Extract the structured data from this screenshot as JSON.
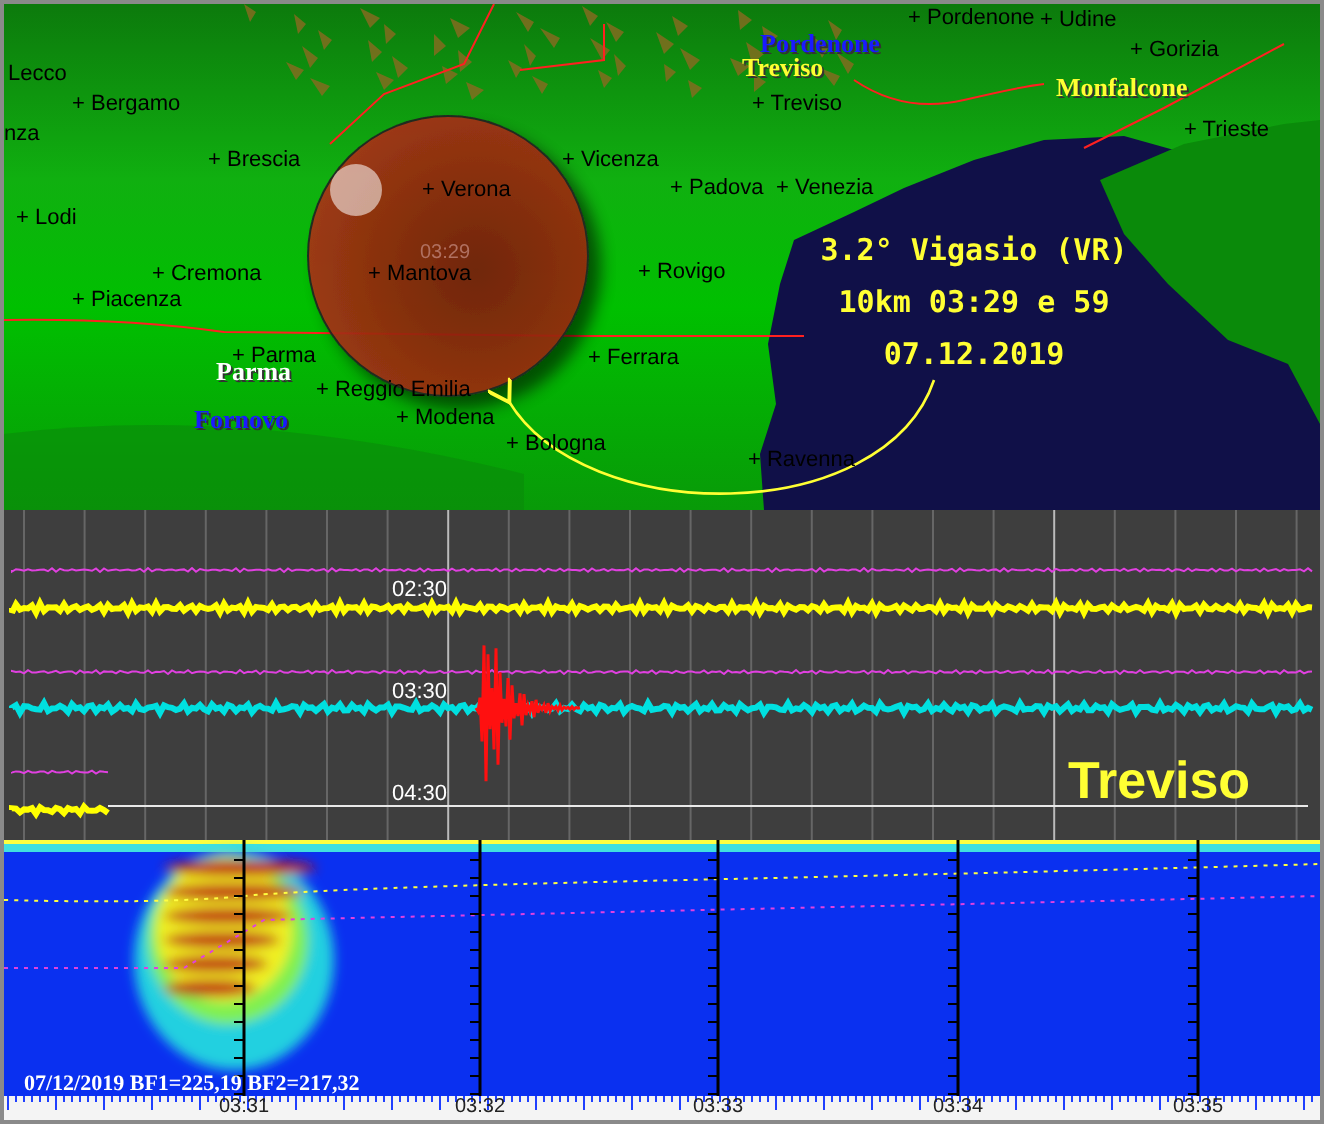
{
  "map": {
    "cities": [
      "Lecco",
      "+ Bergamo",
      "nza",
      "+ Brescia",
      "+ Lodi",
      "+ Cremona",
      "+ Piacenza",
      "+ Parma",
      "+ Reggio Emilia",
      "+ Modena",
      "+ Bologna",
      "+ Verona",
      "+ Mantova",
      "+ Vicenza",
      "+ Ferrara",
      "+ Padova",
      "+ Venezia",
      "+ Rovigo",
      "+ Treviso",
      "+ Pordenone",
      "+ Udine",
      "+ Gorizia",
      "+ Trieste",
      "+ Ravenna"
    ],
    "region_labels": [
      {
        "name": "Treviso",
        "color": "#ffff33"
      },
      {
        "name": "Monfalcone",
        "color": "#ffff33"
      },
      {
        "name": "Parma",
        "color": "#ffffff"
      },
      {
        "name": "Fornovo",
        "color": "#1a1aff"
      },
      {
        "name": "Pordenone",
        "color": "#1a1aff"
      }
    ],
    "epicenter": {
      "time": "03:29"
    },
    "event": {
      "lines": [
        "3.2° Vigasio (VR)",
        "10km 03:29 e 59",
        "07.12.2019"
      ]
    }
  },
  "seismogram": {
    "rows": [
      {
        "time": "02:30"
      },
      {
        "time": "03:30"
      },
      {
        "time": "04:30"
      }
    ],
    "station": "Treviso"
  },
  "spectrogram": {
    "caption": "07/12/2019 BF1=225,19 BF2=217,32",
    "ticks": [
      "03:31",
      "03:32",
      "03:33",
      "03:34",
      "03:35"
    ]
  }
}
